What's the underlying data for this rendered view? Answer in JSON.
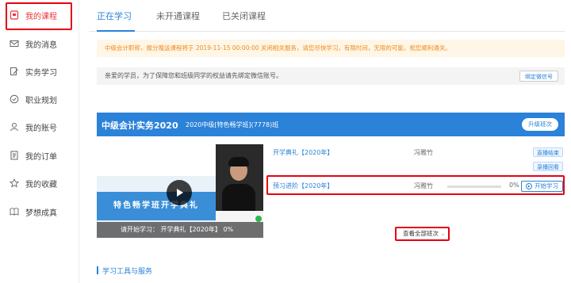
{
  "sidebar": {
    "items": [
      {
        "label": "我的课程",
        "icon": "course-icon",
        "active": true
      },
      {
        "label": "我的消息",
        "icon": "mail-icon"
      },
      {
        "label": "实务学习",
        "icon": "edit-icon"
      },
      {
        "label": "职业规划",
        "icon": "compass-icon"
      },
      {
        "label": "我的账号",
        "icon": "user-icon"
      },
      {
        "label": "我的订单",
        "icon": "order-icon"
      },
      {
        "label": "我的收藏",
        "icon": "star-icon"
      },
      {
        "label": "梦想成真",
        "icon": "book-icon"
      }
    ]
  },
  "tabs": [
    {
      "label": "正在学习",
      "active": true
    },
    {
      "label": "未开通课程"
    },
    {
      "label": "已关闭课程"
    }
  ],
  "notice": "中级会计职称，报分赠送课程将于 2019-11-15 00:00:00 关闭相关服务，请您尽快学习，有限时间，无限的可能，祝您顺利通关。",
  "wechat": {
    "text": "亲爱的学员，为了保障您和班级同学的权益请先绑定微信账号。",
    "button": "绑定微信号"
  },
  "course": {
    "title": "中级会计实务2020",
    "class_name": "2020中级[特色畅学班](7778)班",
    "upgrade": "升级班次",
    "video": {
      "slide_text": "特色畅学班开学典礼",
      "caption": "请开始学习： 开学典礼【2020年】 0%"
    },
    "lessons": [
      {
        "title": "开学典礼【2020年】",
        "teacher": "冯雅竹",
        "actions": [
          "直播结束",
          "录播回看"
        ]
      },
      {
        "title": "预习进阶【2020年】",
        "teacher": "冯雅竹",
        "progress": 0,
        "progress_label": "0%",
        "action": "开始学习"
      }
    ],
    "view_all": "查看全部班次"
  },
  "tools": {
    "title": "学习工具与服务"
  },
  "colors": {
    "accent": "#2b82d9",
    "active": "#e8383d",
    "notice": "#f08b1d",
    "highlight": "#e60012"
  }
}
